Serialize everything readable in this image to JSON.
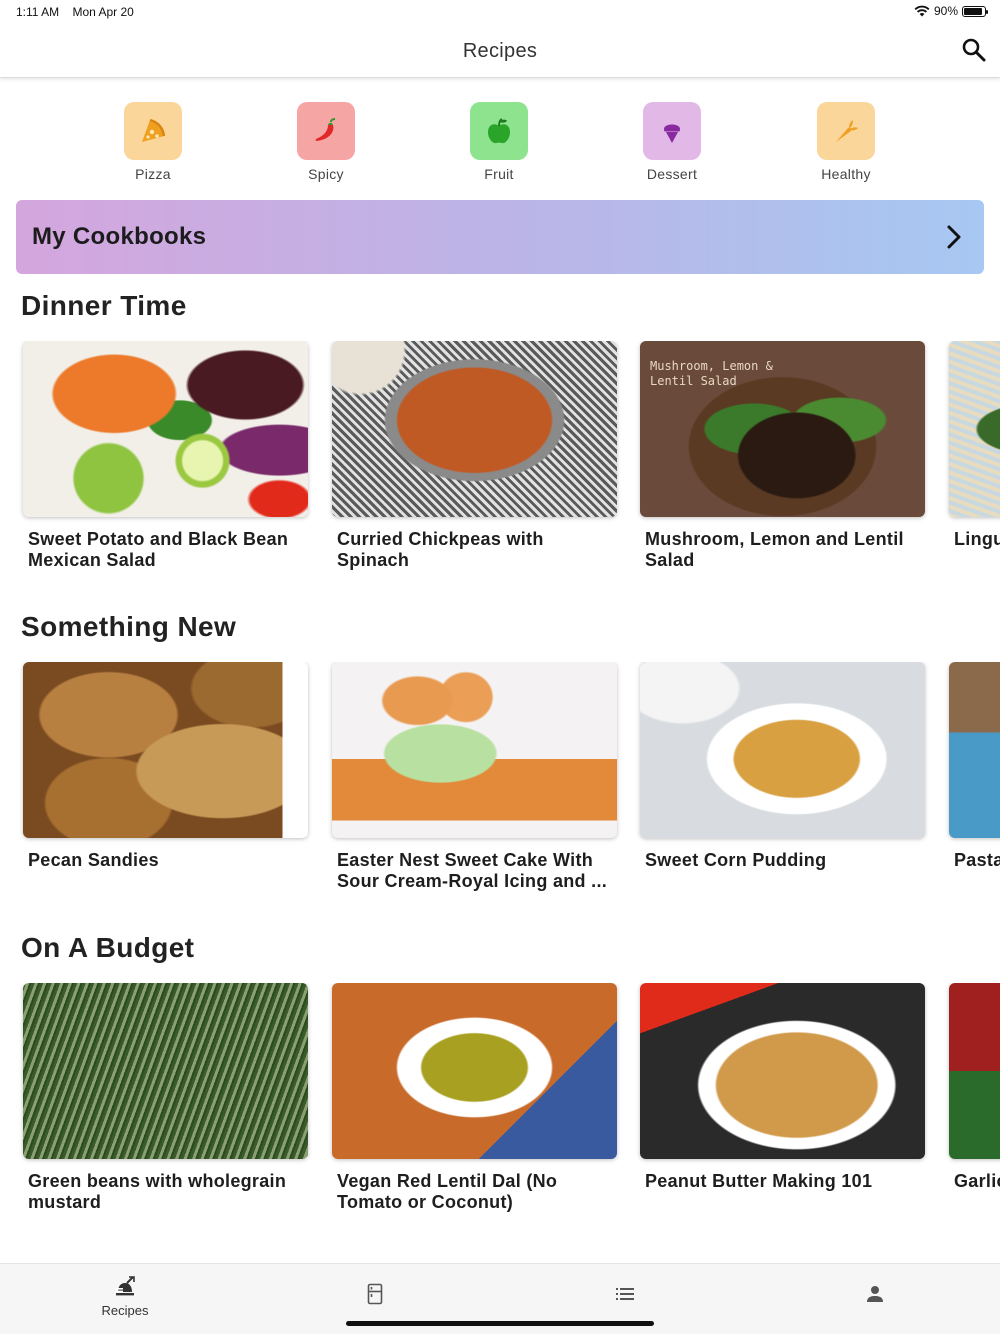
{
  "status_bar": {
    "time": "1:11 AM",
    "date": "Mon Apr 20",
    "battery_text": "90%",
    "battery_level": 0.9
  },
  "nav": {
    "title": "Recipes"
  },
  "categories": [
    {
      "label": "Pizza",
      "icon": "pizza-icon",
      "bg": "#fbd69a",
      "fg": "#f0a020"
    },
    {
      "label": "Spicy",
      "icon": "chili-pepper-icon",
      "bg": "#f6a5a5",
      "fg": "#e02828"
    },
    {
      "label": "Fruit",
      "icon": "apple-icon",
      "bg": "#8ee38e",
      "fg": "#2aa52a"
    },
    {
      "label": "Dessert",
      "icon": "ice-cream-icon",
      "bg": "#e2b8e6",
      "fg": "#8a2aa0"
    },
    {
      "label": "Healthy",
      "icon": "carrot-icon",
      "bg": "#fbd69a",
      "fg": "#f0a020"
    }
  ],
  "cookbooks": {
    "label": "My Cookbooks"
  },
  "sections": [
    {
      "title": "Dinner Time",
      "cards": [
        {
          "title": "Sweet Potato and Black Bean Mexican Salad"
        },
        {
          "title": "Curried Chickpeas with Spinach"
        },
        {
          "title": "Mushroom, Lemon and Lentil Salad",
          "image_text": "Mushroom, Lemon &\nLentil Salad"
        },
        {
          "title": "Linguine with White"
        }
      ]
    },
    {
      "title": "Something New",
      "cards": [
        {
          "title": "Pecan Sandies"
        },
        {
          "title": "Easter Nest Sweet Cake With Sour Cream-Royal Icing and ..."
        },
        {
          "title": "Sweet Corn Pudding"
        },
        {
          "title": "Pasta Lemon"
        }
      ]
    },
    {
      "title": "On A Budget",
      "cards": [
        {
          "title": "Green beans with wholegrain mustard"
        },
        {
          "title": "Vegan Red Lentil Dal (No Tomato or Coconut)"
        },
        {
          "title": "Peanut Butter Making 101"
        },
        {
          "title": "Garlic"
        }
      ]
    }
  ],
  "tab_bar": {
    "tabs": [
      {
        "label": "Recipes",
        "icon": "chef-hat-icon"
      },
      {
        "label": "",
        "icon": "fridge-icon"
      },
      {
        "label": "",
        "icon": "list-icon"
      },
      {
        "label": "",
        "icon": "person-icon"
      }
    ]
  }
}
